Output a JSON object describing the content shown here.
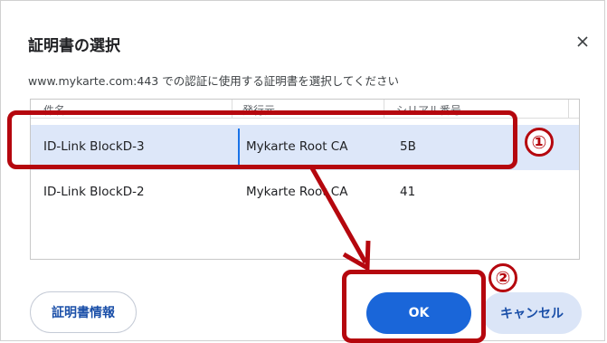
{
  "dialog": {
    "title": "証明書の選択",
    "subtitle": "www.mykarte.com:443 での認証に使用する証明書を選択してください"
  },
  "table": {
    "columns": [
      "件名",
      "発行元",
      "シリアル番号"
    ],
    "rows": [
      {
        "subject": "ID-Link BlockD-3",
        "issuer": "Mykarte Root CA",
        "serial": "5B",
        "selected": true
      },
      {
        "subject": "ID-Link BlockD-2",
        "issuer": "Mykarte Root CA",
        "serial": "41",
        "selected": false
      }
    ]
  },
  "buttons": {
    "cert_info": "証明書情報",
    "ok": "OK",
    "cancel": "キャンセル"
  },
  "annotations": {
    "step1": "①",
    "step2": "②",
    "highlight_color": "#b5070e"
  },
  "icons": {
    "close": "close-icon"
  }
}
